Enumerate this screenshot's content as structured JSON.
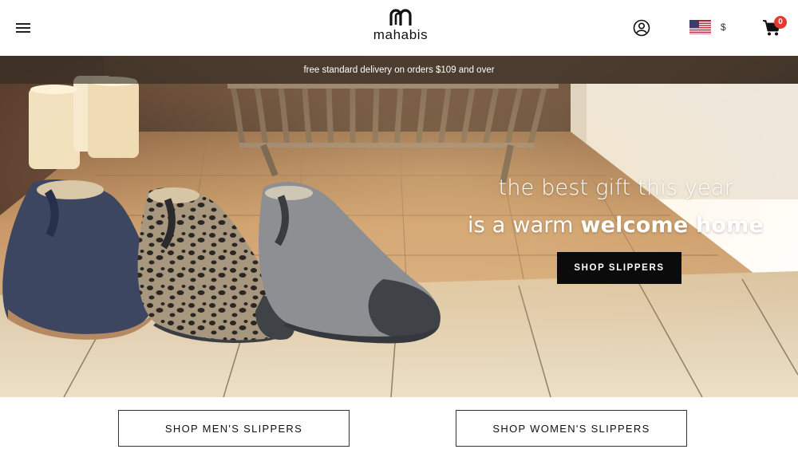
{
  "header": {
    "brand": "mahabis",
    "currency_symbol": "$",
    "cart_count": "0",
    "icons": {
      "menu": "hamburger-menu-icon",
      "account": "user-circle-icon",
      "flag": "us-flag-icon",
      "cart": "shopping-cart-icon"
    }
  },
  "hero": {
    "promo_text": "free standard delivery on orders $109 and over",
    "headline_line1": "the best gift this year",
    "headline_line2_light": "is a warm ",
    "headline_line2_bold": "welcome home",
    "cta_label": "SHOP SLIPPERS",
    "image_subject": "three felt slippers (navy, leopard, grey) on a wooden floor by a fireplace with candles"
  },
  "buttons": {
    "mens_label": "SHOP MEN'S SLIPPERS",
    "womens_label": "SHOP WOMEN'S SLIPPERS"
  },
  "colors": {
    "cta_background": "#0b0b0b",
    "badge": "#e53a2e",
    "promo_bar": "#2d2822"
  }
}
